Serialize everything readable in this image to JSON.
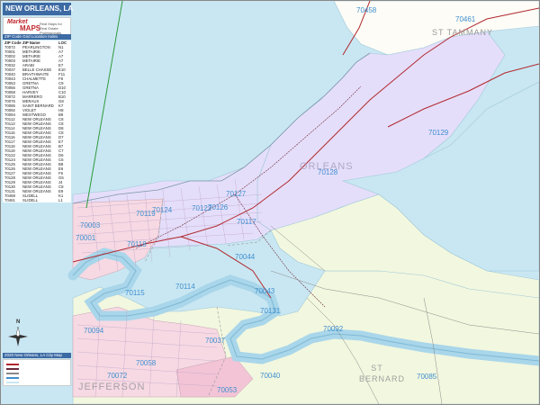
{
  "title": "NEW ORLEANS, LA",
  "logo": {
    "brand_top": "Market",
    "brand_main": "MAPS",
    "tagline": "Real Maps for Real Estate Professionals",
    "contact": "www.marketmaps.com"
  },
  "zip_list": {
    "header": "ZIP Code Grid Location Index",
    "columns": [
      "ZIP Code",
      "ZIP Name",
      "LOC"
    ],
    "rows": [
      [
        "70072",
        "PEARLINGTON",
        "N1"
      ],
      [
        "70001",
        "METAIRIE",
        "A7"
      ],
      [
        "70002",
        "METAIRIE",
        "A7"
      ],
      [
        "70003",
        "METAIRIE",
        "A7"
      ],
      [
        "70032",
        "ARABI",
        "E7"
      ],
      [
        "70037",
        "BELLE CHASSE",
        "E10"
      ],
      [
        "70040",
        "BRAITHWAITE",
        "F11"
      ],
      [
        "70043",
        "CHALMETTE",
        "F8"
      ],
      [
        "70053",
        "GRETNA",
        "C9"
      ],
      [
        "70056",
        "GRETNA",
        "D10"
      ],
      [
        "70058",
        "HARVEY",
        "C10"
      ],
      [
        "70072",
        "MARRERO",
        "B10"
      ],
      [
        "70075",
        "MERAUX",
        "G8"
      ],
      [
        "70085",
        "SAINT BERNARD",
        "K7"
      ],
      [
        "70092",
        "VIOLET",
        "H8"
      ],
      [
        "70094",
        "WESTWEGO",
        "B9"
      ],
      [
        "70112",
        "NEW ORLEANS",
        "C8"
      ],
      [
        "70113",
        "NEW ORLEANS",
        "C8"
      ],
      [
        "70114",
        "NEW ORLEANS",
        "D8"
      ],
      [
        "70115",
        "NEW ORLEANS",
        "C8"
      ],
      [
        "70116",
        "NEW ORLEANS",
        "D7"
      ],
      [
        "70117",
        "NEW ORLEANS",
        "E7"
      ],
      [
        "70118",
        "NEW ORLEANS",
        "B7"
      ],
      [
        "70119",
        "NEW ORLEANS",
        "C7"
      ],
      [
        "70122",
        "NEW ORLEANS",
        "D6"
      ],
      [
        "70124",
        "NEW ORLEANS",
        "C6"
      ],
      [
        "70125",
        "NEW ORLEANS",
        "B8"
      ],
      [
        "70126",
        "NEW ORLEANS",
        "E6"
      ],
      [
        "70127",
        "NEW ORLEANS",
        "F6"
      ],
      [
        "70128",
        "NEW ORLEANS",
        "G5"
      ],
      [
        "70129",
        "NEW ORLEANS",
        "J4"
      ],
      [
        "70130",
        "NEW ORLEANS",
        "C8"
      ],
      [
        "70131",
        "NEW ORLEANS",
        "E9"
      ],
      [
        "70458",
        "SLIDELL",
        "K1"
      ],
      [
        "70461",
        "SLIDELL",
        "L1"
      ]
    ]
  },
  "inset_header": "2020 New Orleans, LA City Map",
  "parish_labels": [
    "ST TAMMANY",
    "ORLEANS",
    "JEFFERSON",
    "ST BERNARD"
  ],
  "zip_labels": [
    "70461",
    "70458",
    "70129",
    "70128",
    "70127",
    "70126",
    "70122",
    "70124",
    "70117",
    "70119",
    "70118",
    "70115",
    "70114",
    "70044",
    "70043",
    "70131",
    "70092",
    "70094",
    "70058",
    "70037",
    "70040",
    "70072",
    "70085",
    "70003",
    "70001",
    "70053"
  ],
  "colors": {
    "water": "#c9e7f2",
    "land": "#fdfcf6",
    "orleans_fill": "#e5defa",
    "jefferson_fill": "#f6d9e3",
    "stbernard_fill": "#f2f7df",
    "zip_label": "#3f8fd0",
    "parish_label": "#9a9a9a",
    "header_blue": "#3c6aa3",
    "highway": "#b0282f"
  },
  "compass_label": "N"
}
